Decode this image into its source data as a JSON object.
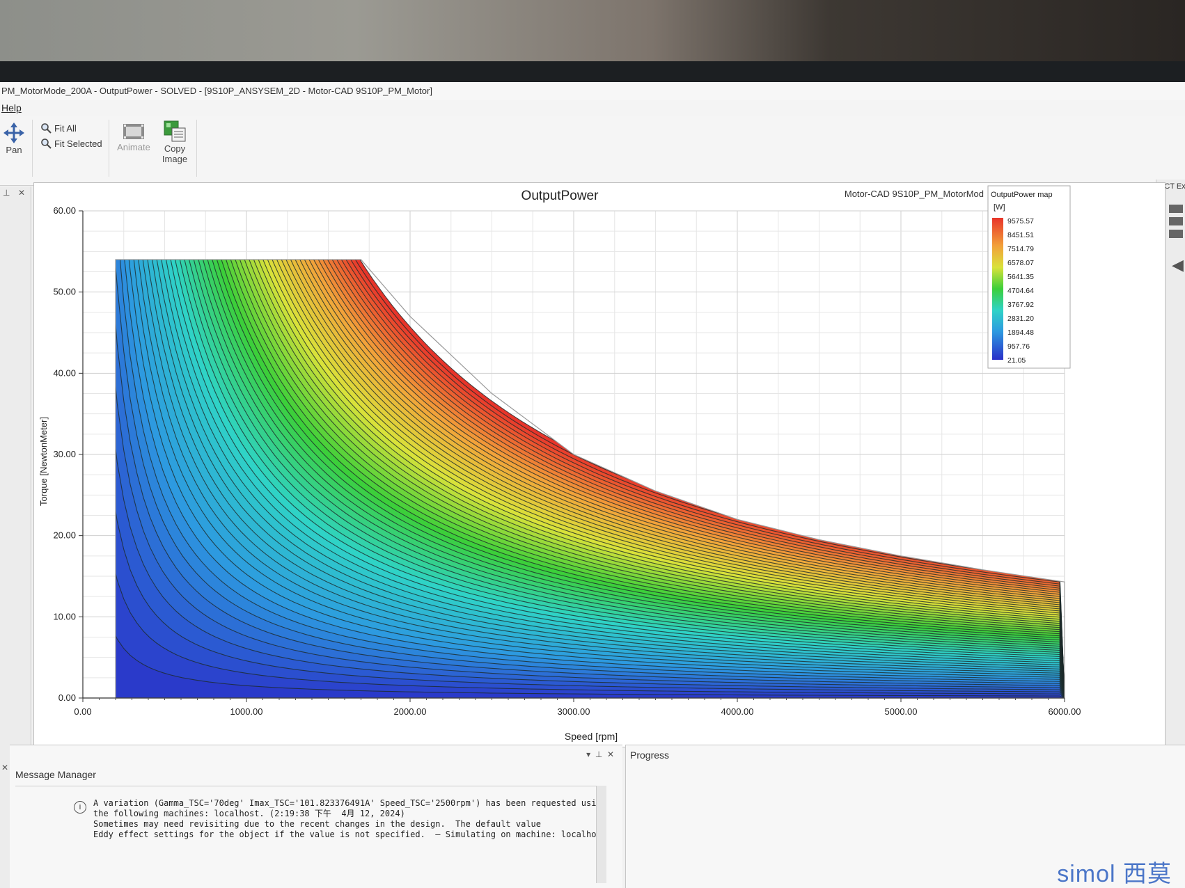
{
  "window": {
    "title": "PM_MotorMode_200A - OutputPower - SOLVED - [9S10P_ANSYSEM_2D - Motor-CAD 9S10P_PM_Motor]"
  },
  "menu": {
    "items": [
      "Help"
    ]
  },
  "toolbar": {
    "pan": "Pan",
    "fit_all": "Fit All",
    "fit_selected": "Fit Selected",
    "animate": "Animate",
    "copy_image_line1": "Copy",
    "copy_image_line2": "Image"
  },
  "side_panel": {
    "right_label": "ACT Ex"
  },
  "plot": {
    "title": "OutputPower",
    "subtitle": "Motor-CAD 9S10P_PM_MotorMod",
    "legend_title": "OutputPower map",
    "legend_unit": "[W]",
    "legend_values": [
      "9575.57",
      "8451.51",
      "7514.79",
      "6578.07",
      "5641.35",
      "4704.64",
      "3767.92",
      "2831.20",
      "1894.48",
      "957.76",
      "21.05"
    ],
    "colors": [
      "#e8342a",
      "#f2a23a",
      "#d9e23a",
      "#3ccf3a",
      "#2fd3c6",
      "#2d9ae0",
      "#2a2fc8"
    ]
  },
  "chart_data": {
    "type": "heatmap",
    "title": "OutputPower",
    "xlabel": "Speed [rpm]",
    "ylabel": "Torque [NewtonMeter]",
    "xlim": [
      0,
      6000
    ],
    "ylim": [
      0,
      60
    ],
    "x_ticks": [
      "0.00",
      "1000.00",
      "2000.00",
      "3000.00",
      "4000.00",
      "5000.00",
      "6000.00"
    ],
    "y_ticks": [
      "0.00",
      "10.00",
      "20.00",
      "30.00",
      "40.00",
      "50.00",
      "60.00"
    ],
    "envelope": {
      "speed": [
        200,
        1700,
        2000,
        2500,
        3000,
        3500,
        4000,
        4500,
        5000,
        5500,
        6000
      ],
      "torque": [
        54,
        54,
        47,
        37.5,
        30,
        25.5,
        22,
        19.5,
        17.5,
        15.8,
        14.3
      ]
    },
    "color_range": [
      21.05,
      9575.57
    ],
    "grid": true,
    "legend": "top-right"
  },
  "messages": {
    "panel_title": "Message Manager",
    "text": "A variation (Gamma_TSC='70deg' Imax_TSC='101.823376491A' Speed_TSC='2500rpm') has been requested using\nthe following machines: localhost. (2:19:38 下午  4月 12, 2024)\nSometimes may need revisiting due to the recent changes in the design.  The default value\nEddy effect settings for the object if the value is not specified.  — Simulating on machine: localhost"
  },
  "progress": {
    "panel_title": "Progress"
  },
  "watermark": "simol 西莫"
}
